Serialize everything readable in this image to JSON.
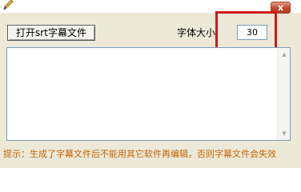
{
  "title_bar": {
    "app_icon": "pencil-icon",
    "close_label": "x"
  },
  "toolbar": {
    "open_button_label": "打开srt字幕文件",
    "font_size_label": "字体大小",
    "font_size_value": "30"
  },
  "editor": {
    "content": "",
    "scroll_up_icon": "scroll-up-arrow-icon",
    "scroll_down_icon": "scroll-down-arrow-icon"
  },
  "footer": {
    "hint": "提示：生成了字幕文件后不能用其它软件再编辑，否则字幕文件会失效"
  },
  "colors": {
    "window_bg": "#ece9d8",
    "highlight": "#d01818",
    "hint_text": "#c86400",
    "close_button": "#c4482e"
  }
}
